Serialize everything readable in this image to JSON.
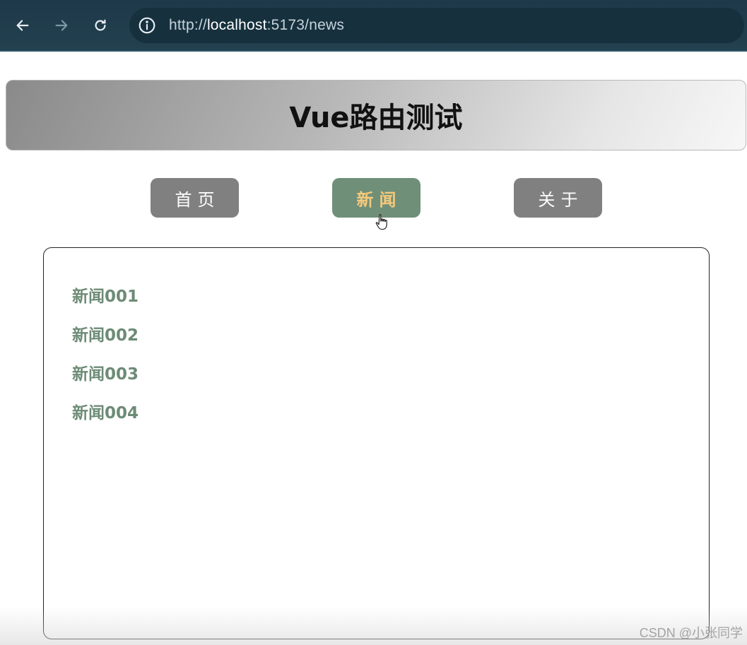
{
  "browser": {
    "url_prefix": "http://",
    "url_host": "localhost",
    "url_suffix": ":5173/news",
    "bar_color": "#1e3a4a",
    "icons": [
      "back-arrow-icon",
      "forward-arrow-icon",
      "reload-icon",
      "info-icon"
    ]
  },
  "header": {
    "title": "Vue路由测试"
  },
  "nav": {
    "items": [
      {
        "label": "首页",
        "active": false
      },
      {
        "label": "新闻",
        "active": true
      },
      {
        "label": "关于",
        "active": false
      }
    ],
    "active_bg": "#6f8f78",
    "active_text_color": "#f5c97a",
    "inactive_bg": "#808080"
  },
  "news": {
    "items": [
      "新闻001",
      "新闻002",
      "新闻003",
      "新闻004"
    ],
    "text_color": "#6d8b76"
  },
  "watermark": "CSDN @小张同学"
}
